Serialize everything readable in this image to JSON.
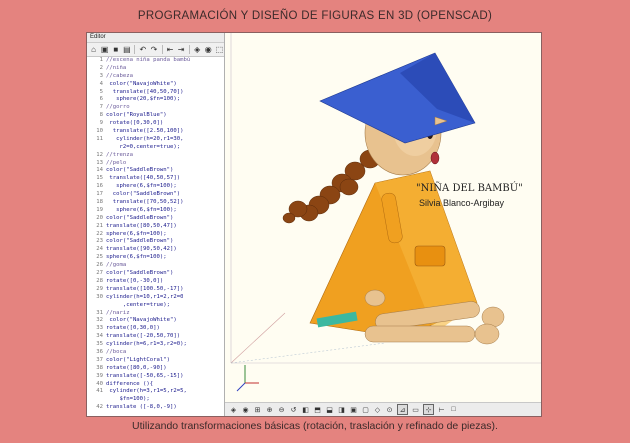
{
  "page": {
    "title": "PROGRAMACIÓN Y DISEÑO DE FIGURAS EN 3D (OPENSCAD)",
    "caption": "Utilizando transformaciones básicas (rotación, traslación y refinado de piezas)."
  },
  "editor": {
    "title": "Editor",
    "toolbar_icons": [
      "home-icon",
      "open-icon",
      "save-icon",
      "save-alt-icon",
      "undo-icon",
      "redo-icon",
      "unindent-icon",
      "indent-icon",
      "preview-icon",
      "render-icon",
      "export-icon"
    ],
    "lines": [
      {
        "n": "1",
        "t": "//escena niña panda bambú",
        "k": "cm"
      },
      {
        "n": "2",
        "t": "//niña",
        "k": "cm"
      },
      {
        "n": "3",
        "t": "//cabeza",
        "k": "cm"
      },
      {
        "n": "4",
        "t": " color(\"NavajoWhite\")",
        "k": "kw"
      },
      {
        "n": "5",
        "t": "  translate([40,50,70])",
        "k": "kw"
      },
      {
        "n": "6",
        "t": "   sphere(20,$fn=100);",
        "k": "kw"
      },
      {
        "n": "7",
        "t": "//gorro",
        "k": "cm"
      },
      {
        "n": "8",
        "t": "color(\"RoyalBlue\")",
        "k": "kw"
      },
      {
        "n": "9",
        "t": " rotate([0,30,0])",
        "k": "kw"
      },
      {
        "n": "10",
        "t": "  translate([2.50,100])",
        "k": "kw"
      },
      {
        "n": "11",
        "t": "   cylinder(h=20,r1=30,",
        "k": "kw"
      },
      {
        "n": "",
        "t": "    r2=0,center=true);",
        "k": "kw"
      },
      {
        "n": "12",
        "t": "//trenza",
        "k": "cm"
      },
      {
        "n": "13",
        "t": "//pelo",
        "k": "cm"
      },
      {
        "n": "14",
        "t": "color(\"SaddleBrown\")",
        "k": "kw"
      },
      {
        "n": "15",
        "t": " translate([40,50,57])",
        "k": "kw"
      },
      {
        "n": "16",
        "t": "   sphere(6,$fn=100);",
        "k": "kw"
      },
      {
        "n": "17",
        "t": "  color(\"SaddleBrown\")",
        "k": "kw"
      },
      {
        "n": "18",
        "t": "  translate([70,50,52])",
        "k": "kw"
      },
      {
        "n": "19",
        "t": "   sphere(6,$fn=100);",
        "k": "kw"
      },
      {
        "n": "20",
        "t": "color(\"SaddleBrown\")",
        "k": "kw"
      },
      {
        "n": "21",
        "t": "translate([80,50,47])",
        "k": "kw"
      },
      {
        "n": "22",
        "t": "sphere(6,$fn=100);",
        "k": "kw"
      },
      {
        "n": "23",
        "t": "color(\"SaddleBrown\")",
        "k": "kw"
      },
      {
        "n": "24",
        "t": "translate([90,50,42])",
        "k": "kw"
      },
      {
        "n": "25",
        "t": "sphere(6,$fn=100);",
        "k": "kw"
      },
      {
        "n": "26",
        "t": "//goma",
        "k": "cm"
      },
      {
        "n": "27",
        "t": "color(\"SaddleBrown\")",
        "k": "kw"
      },
      {
        "n": "28",
        "t": "rotate([0,-30,0])",
        "k": "kw"
      },
      {
        "n": "29",
        "t": "translate([100.50,-17])",
        "k": "kw"
      },
      {
        "n": "30",
        "t": "cylinder(h=10,r1=2,r2=0",
        "k": "kw"
      },
      {
        "n": "",
        "t": "     ,center=true);",
        "k": "kw"
      },
      {
        "n": "31",
        "t": "//nariz",
        "k": "cm"
      },
      {
        "n": "32",
        "t": " color(\"NavajoWhite\")",
        "k": "kw"
      },
      {
        "n": "33",
        "t": "rotate([0,30,0])",
        "k": "kw"
      },
      {
        "n": "34",
        "t": "translate([-20,50,70])",
        "k": "kw"
      },
      {
        "n": "35",
        "t": "cylinder(h=6,r1=3,r2=0);",
        "k": "kw"
      },
      {
        "n": "36",
        "t": "//boca",
        "k": "cm"
      },
      {
        "n": "37",
        "t": "color(\"LightCoral\")",
        "k": "kw"
      },
      {
        "n": "38",
        "t": "rotate([80,0,-90])",
        "k": "kw"
      },
      {
        "n": "39",
        "t": "translate([-50,65,-15])",
        "k": "kw"
      },
      {
        "n": "40",
        "t": "difference (){",
        "k": "kw"
      },
      {
        "n": "41",
        "t": " cylinder(h=3,r1=5,r2=5,",
        "k": "kw"
      },
      {
        "n": "",
        "t": "    $fn=100);",
        "k": "kw"
      },
      {
        "n": "42",
        "t": "translate ([-8,0,-9])",
        "k": "kw"
      }
    ]
  },
  "viewport": {
    "overlay_title": "\"NIÑA DEL BAMBÚ\"",
    "overlay_author": "Silvia Blanco-Argibay",
    "toolbar_icons": [
      "preview-icon",
      "render-icon",
      "zoom-all-icon",
      "zoom-in-icon",
      "zoom-out-icon",
      "reset-view-icon",
      "view-right-icon",
      "view-top-icon",
      "view-bottom-icon",
      "view-left-icon",
      "view-front-icon",
      "view-back-icon",
      "view-diagonal-icon",
      "view-center-icon",
      "perspective-icon",
      "orthogonal-icon",
      "axes-icon",
      "scale-markers-icon",
      "edges-icon"
    ],
    "colors": {
      "hat": "#3a5fd0",
      "skin": "#e8c28f",
      "hair": "#8b4513",
      "dress": "#f0a020",
      "mouth": "#b0303a",
      "band": "#3cb8a0"
    }
  }
}
